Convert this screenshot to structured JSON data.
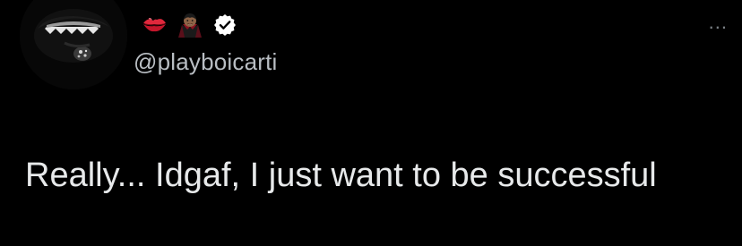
{
  "tweet": {
    "handle": "@playboicarti",
    "text": "Really... Idgaf, I just want to be successful",
    "more_label": "...",
    "name_emojis": [
      "kiss-mark-emoji",
      "vampire-emoji"
    ],
    "verified_icon": "verified-badge-icon"
  },
  "colors": {
    "background": "#000000",
    "text": "#e7e9ea",
    "handle": "#b9bec3",
    "verified": "#ffffff",
    "kiss": "#e0283c"
  }
}
